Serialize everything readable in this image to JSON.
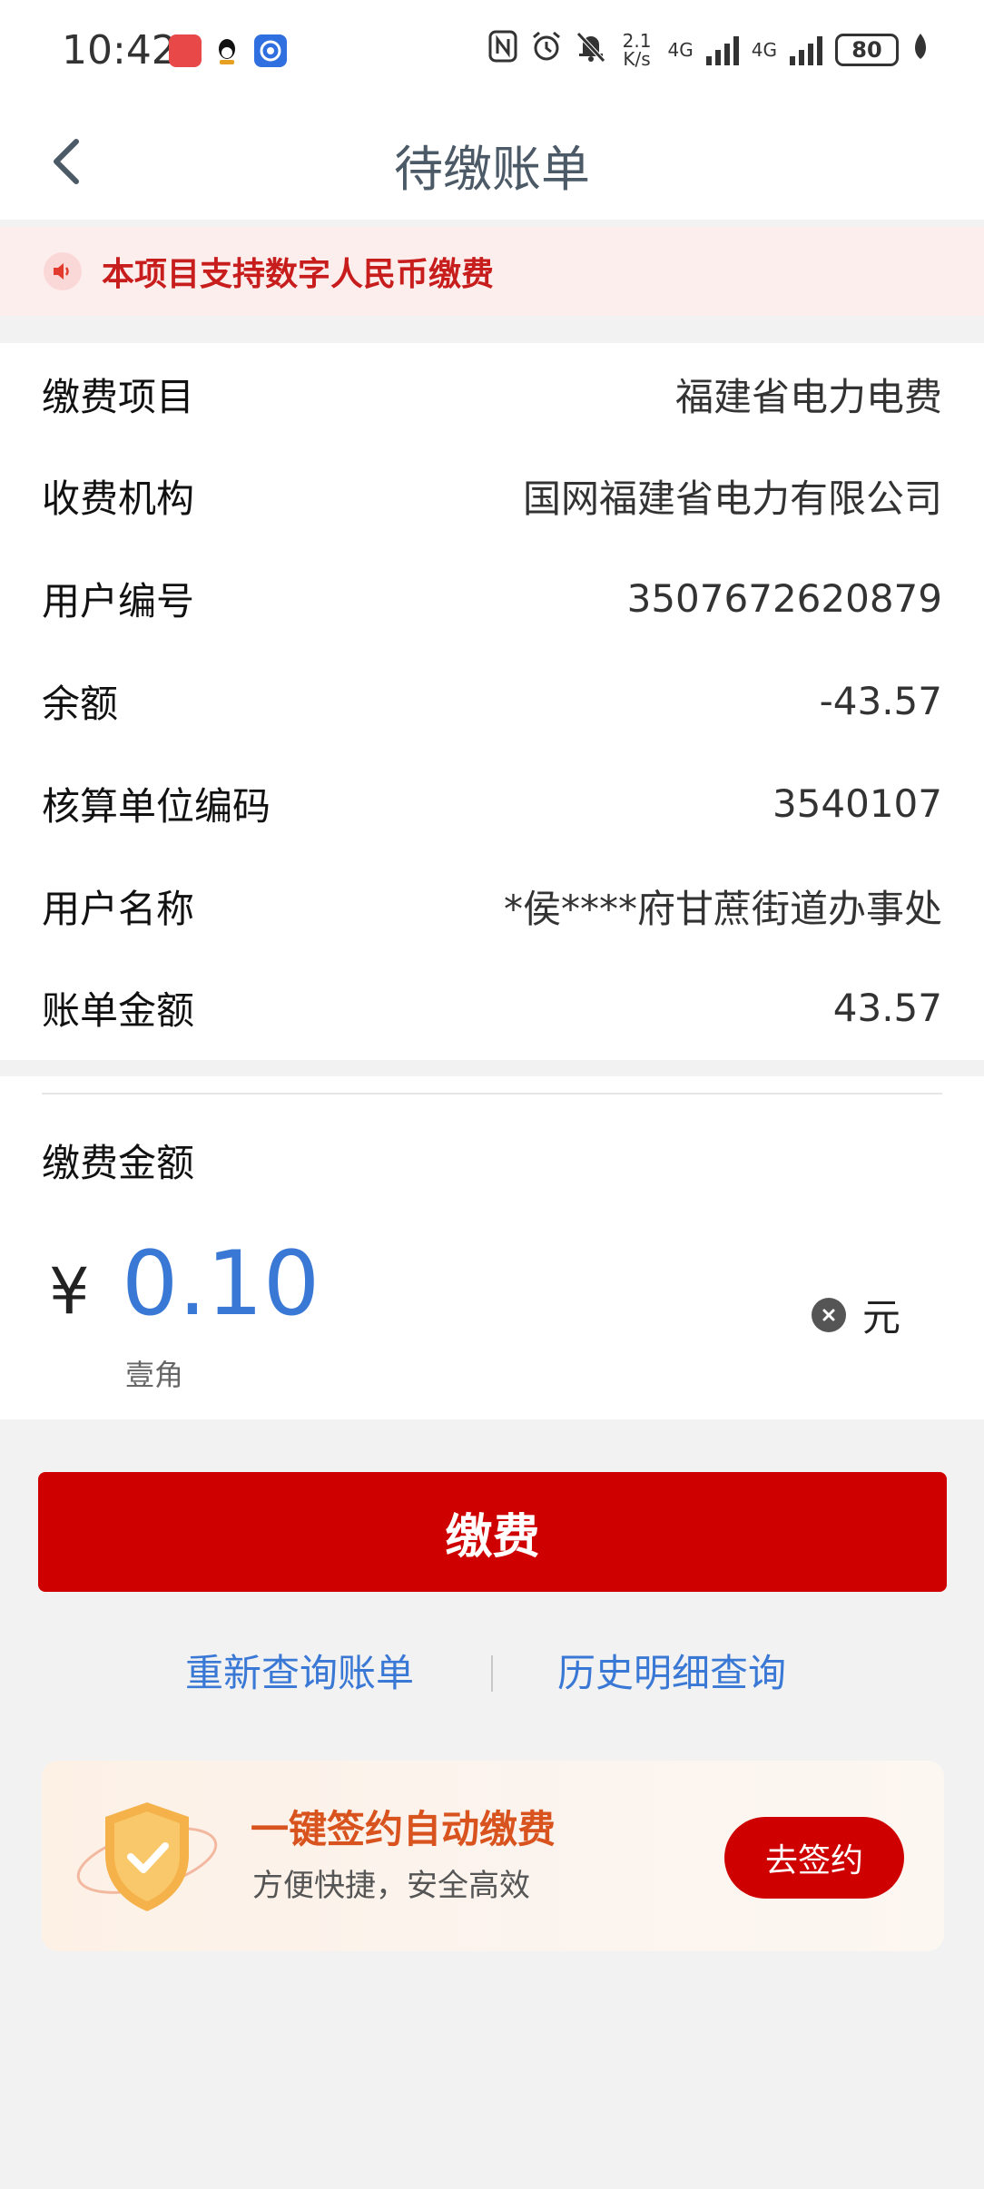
{
  "status_bar": {
    "time": "10:42",
    "speed": "2.1\nK/s",
    "network1": "4G",
    "network2": "4G",
    "battery": "80",
    "icons": [
      "nfc-icon",
      "alarm-icon",
      "mute-icon",
      "signal-icon",
      "signal-icon",
      "battery-icon",
      "leaf-icon"
    ]
  },
  "nav": {
    "title": "待缴账单",
    "back_icon": "chevron-left-icon"
  },
  "notice": {
    "icon": "speaker-icon",
    "text": "本项目支持数字人民币缴费"
  },
  "info": {
    "rows": [
      {
        "label": "缴费项目",
        "value": "福建省电力电费"
      },
      {
        "label": "收费机构",
        "value": "国网福建省电力有限公司"
      },
      {
        "label": "用户编号",
        "value": "3507672620879"
      },
      {
        "label": "余额",
        "value": "-43.57"
      },
      {
        "label": "核算单位编码",
        "value": "3540107"
      },
      {
        "label": "用户名称",
        "value": "*侯****府甘蔗街道办事处"
      },
      {
        "label": "账单金额",
        "value": "43.57"
      }
    ]
  },
  "payment": {
    "label": "缴费金额",
    "currency_symbol": "¥",
    "amount": "0.10",
    "amount_words": "壹角",
    "unit": "元",
    "clear_icon": "clear-icon"
  },
  "pay_button": {
    "label": "缴费"
  },
  "links": {
    "requery": "重新查询账单",
    "history": "历史明细查询"
  },
  "promo": {
    "title": "一键签约自动缴费",
    "subtitle": "方便快捷，安全高效",
    "button": "去签约",
    "icon": "shield-icon"
  },
  "colors": {
    "accent_red": "#cf0000",
    "link_blue": "#3a78d6",
    "notice_bg": "#fdeeee",
    "promo_title": "#d9531e"
  }
}
